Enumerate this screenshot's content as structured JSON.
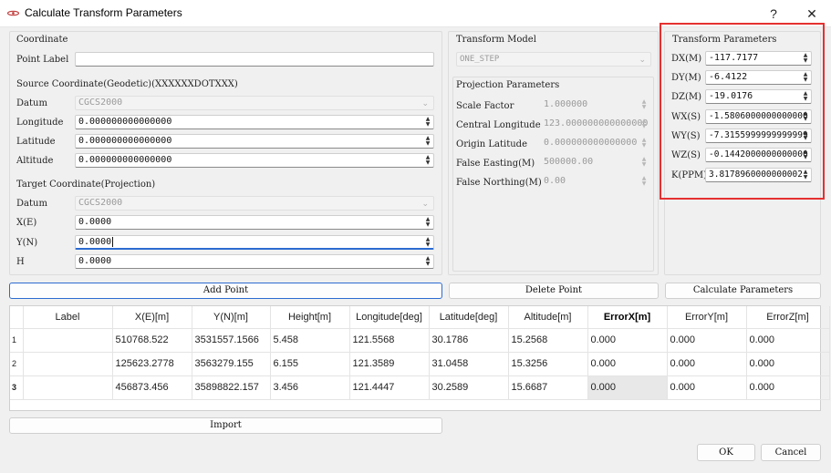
{
  "window": {
    "title": "Calculate Transform Parameters",
    "help_glyph": "?",
    "close_glyph": "✕"
  },
  "coordinate": {
    "title": "Coordinate",
    "point_label": {
      "label": "Point Label",
      "value": ""
    },
    "source": {
      "title": "Source Coordinate(Geodetic)(XXXXXXDOTXXX)",
      "datum": {
        "label": "Datum",
        "value": "CGCS2000"
      },
      "longitude": {
        "label": "Longitude",
        "value": "0.000000000000000"
      },
      "latitude": {
        "label": "Latitude",
        "value": "0.000000000000000"
      },
      "altitude": {
        "label": "Altitude",
        "value": "0.000000000000000"
      }
    },
    "target": {
      "title": "Target Coordinate(Projection)",
      "datum": {
        "label": "Datum",
        "value": "CGCS2000"
      },
      "x": {
        "label": "X(E)",
        "value": "0.0000"
      },
      "y": {
        "label": "Y(N)",
        "value": "0.0000"
      },
      "h": {
        "label": "H",
        "value": "0.0000"
      }
    }
  },
  "transform_model": {
    "title": "Transform Model",
    "value": "ONE_STEP"
  },
  "projection": {
    "title": "Projection Parameters",
    "scale_factor": {
      "label": "Scale Factor",
      "value": "1.000000"
    },
    "central_longitude": {
      "label": "Central Longitude",
      "value": "123.000000000000000"
    },
    "origin_latitude": {
      "label": "Origin Latitude",
      "value": "0.000000000000000"
    },
    "false_easting": {
      "label": "False Easting(M)",
      "value": "500000.00"
    },
    "false_northing": {
      "label": "False Northing(M)",
      "value": "0.00"
    }
  },
  "transform_parameters": {
    "title": "Transform Parameters",
    "dx": {
      "label": "DX(M)",
      "value": "-117.7177"
    },
    "dy": {
      "label": "DY(M)",
      "value": "-6.4122"
    },
    "dz": {
      "label": "DZ(M)",
      "value": "-19.0176"
    },
    "wx": {
      "label": "WX(S)",
      "value": "-1.5806000000000000"
    },
    "wy": {
      "label": "WY(S)",
      "value": "-7.3155999999999999"
    },
    "wz": {
      "label": "WZ(S)",
      "value": "-0.1442000000000000"
    },
    "k": {
      "label": "K(PPM)",
      "value": "3.8178960000000002"
    }
  },
  "buttons": {
    "add_point": "Add Point",
    "delete_point": "Delete Point",
    "calculate_parameters": "Calculate Parameters",
    "import": "Import",
    "ok": "OK",
    "cancel": "Cancel"
  },
  "table": {
    "columns": [
      "Label",
      "X(E)[m]",
      "Y(N)[m]",
      "Height[m]",
      "Longitude[deg]",
      "Latitude[deg]",
      "Altitude[m]",
      "ErrorX[m]",
      "ErrorY[m]",
      "ErrorZ[m]"
    ],
    "rows": [
      {
        "index": "1",
        "cells": [
          "",
          "510768.522",
          "3531557.1566",
          "5.458",
          "121.5568",
          "30.1786",
          "15.2568",
          "0.000",
          "0.000",
          "0.000"
        ]
      },
      {
        "index": "2",
        "cells": [
          "",
          "125623.2778",
          "3563279.155",
          "6.155",
          "121.3589",
          "31.0458",
          "15.3256",
          "0.000",
          "0.000",
          "0.000"
        ]
      },
      {
        "index": "3",
        "cells": [
          "",
          "456873.456",
          "35898822.157",
          "3.456",
          "121.4447",
          "30.2589",
          "15.6687",
          "0.000",
          "0.000",
          "0.000"
        ]
      }
    ]
  },
  "colors": {
    "highlight_border": "#e53030",
    "focus_accent": "#2c6bd1"
  }
}
